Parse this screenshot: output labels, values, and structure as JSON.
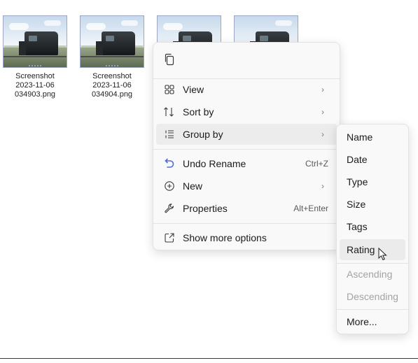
{
  "files": [
    {
      "line1": "Screenshot",
      "line2": "2023-11-06",
      "line3": "034903.png"
    },
    {
      "line1": "Screenshot",
      "line2": "2023-11-06",
      "line3": "034904.png"
    }
  ],
  "context_menu": {
    "top_actions": [
      {
        "icon": "copy-icon"
      }
    ],
    "items": [
      {
        "label": "View",
        "icon": "view-icon",
        "submenu": true
      },
      {
        "label": "Sort by",
        "icon": "sort-icon",
        "submenu": true
      },
      {
        "label": "Group by",
        "icon": "group-icon",
        "submenu": true,
        "active": true
      },
      {
        "label": "Undo Rename",
        "icon": "undo-icon",
        "shortcut": "Ctrl+Z"
      },
      {
        "label": "New",
        "icon": "new-icon",
        "submenu": true
      },
      {
        "label": "Properties",
        "icon": "properties-icon",
        "shortcut": "Alt+Enter"
      },
      {
        "label": "Show more options",
        "icon": "show-more-icon"
      }
    ]
  },
  "group_by_submenu": {
    "items": [
      {
        "label": "Name"
      },
      {
        "label": "Date"
      },
      {
        "label": "Type"
      },
      {
        "label": "Size"
      },
      {
        "label": "Tags"
      },
      {
        "label": "Rating",
        "hovered": true
      },
      {
        "label": "Ascending",
        "disabled": true
      },
      {
        "label": "Descending",
        "disabled": true
      },
      {
        "label": "More..."
      }
    ]
  },
  "colors": {
    "menu_bg": "#f9f9f9",
    "accent": "#4f6bd8",
    "disabled_text": "#a3a3a3"
  }
}
